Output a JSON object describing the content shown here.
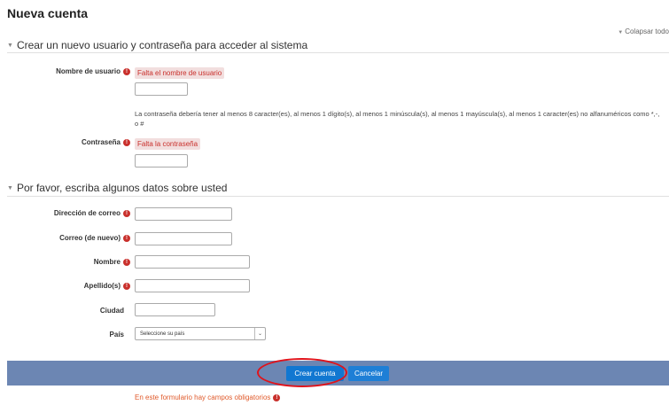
{
  "page": {
    "title": "Nueva cuenta",
    "collapse_all": "Colapsar todo"
  },
  "section1": {
    "header": "Crear un nuevo usuario y contraseña para acceder al sistema",
    "username": {
      "label": "Nombre de usuario",
      "error": "Falta el nombre de usuario",
      "value": ""
    },
    "password_hint": "La contraseña debería tener al menos 8 caracter(es), al menos 1 dígito(s), al menos 1 minúscula(s), al menos 1 mayúscula(s), al menos 1 caracter(es) no alfanuméricos como *,-, o #",
    "password": {
      "label": "Contraseña",
      "error": "Falta la contraseña",
      "value": ""
    }
  },
  "section2": {
    "header": "Por favor, escriba algunos datos sobre usted",
    "email": {
      "label": "Dirección de correo",
      "value": ""
    },
    "email2": {
      "label": "Correo (de nuevo)",
      "value": ""
    },
    "firstname": {
      "label": "Nombre",
      "value": ""
    },
    "lastname": {
      "label": "Apellido(s)",
      "value": ""
    },
    "city": {
      "label": "Ciudad",
      "value": ""
    },
    "country": {
      "label": "País",
      "selected": "Seleccione su país"
    }
  },
  "buttons": {
    "create": "Crear cuenta",
    "cancel": "Cancelar"
  },
  "footer": {
    "required_note": "En este formulario hay campos obligatorios"
  },
  "icons": {
    "required": "!",
    "collapse": "▼",
    "select_arrow": "⌄"
  },
  "colors": {
    "error": "#c9302c",
    "primary": "#1177d1",
    "button_bar": "#6c86b3",
    "annotation": "#e0131b"
  }
}
